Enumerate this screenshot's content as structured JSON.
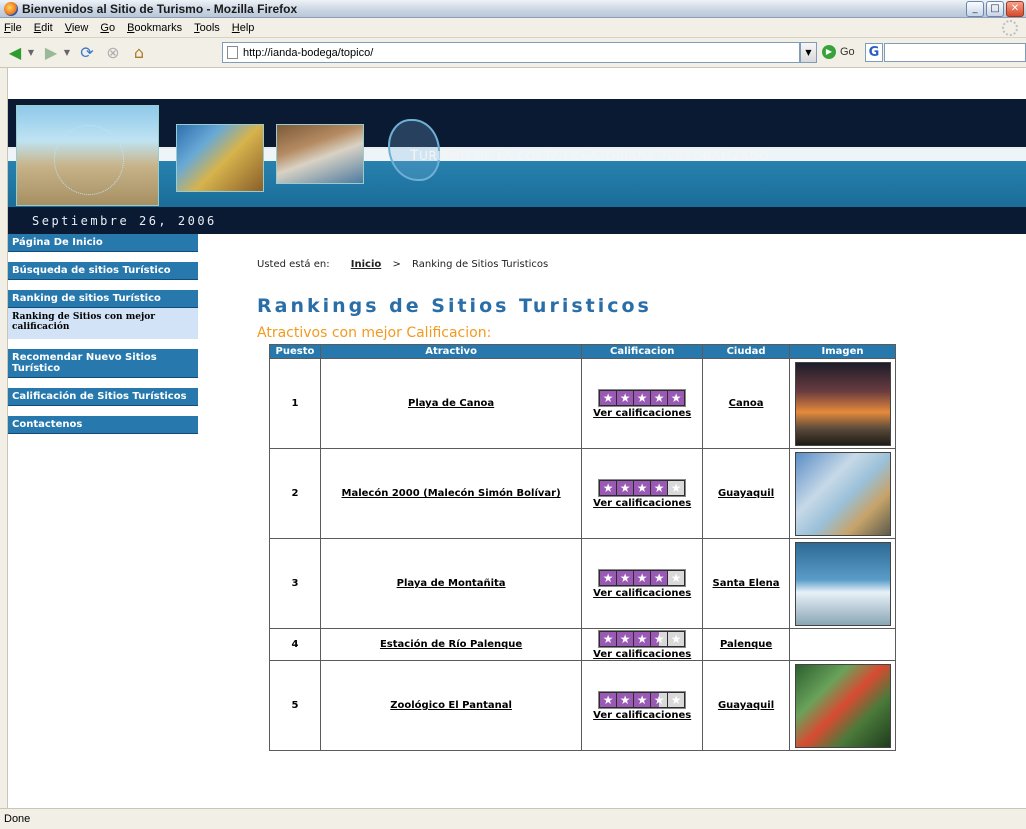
{
  "window": {
    "title": "Bienvenidos al Sitio de Turismo - Mozilla Firefox"
  },
  "menu": {
    "items": [
      "File",
      "Edit",
      "View",
      "Go",
      "Bookmarks",
      "Tools",
      "Help"
    ]
  },
  "navbar": {
    "url": "http://ianda-bodega/topico/",
    "go_label": "Go"
  },
  "banner": {
    "title": "Turismo de la Costa Ecuatoriana Personalizado",
    "date": "Septiembre 26, 2006"
  },
  "sidebar": {
    "items": [
      {
        "label": "Página De Inicio"
      },
      {
        "label": "Búsqueda de sitios Turístico"
      },
      {
        "label": "Ranking de sitios Turístico"
      },
      {
        "label": "Ranking de Sitios con mejor calificación"
      },
      {
        "label": "Recomendar Nuevo Sitios Turístico"
      },
      {
        "label": "Calificación de Sitios Turísticos"
      },
      {
        "label": "Contactenos"
      }
    ]
  },
  "breadcrumb": {
    "prefix": "Usted está en:",
    "home": "Inicio",
    "separator": ">",
    "current": "Ranking de Sitios Turisticos"
  },
  "main": {
    "title": "Rankings de Sitios Turisticos",
    "subtitle": "Atractivos con mejor Calificacion:"
  },
  "table": {
    "headers": [
      "Puesto",
      "Atractivo",
      "Calificacion",
      "Ciudad",
      "Imagen"
    ],
    "rating_link": "Ver calificaciones",
    "rows": [
      {
        "puesto": "1",
        "atractivo": "Playa de Canoa",
        "ciudad": "Canoa",
        "stars": 5,
        "image": "sunset-beach"
      },
      {
        "puesto": "2",
        "atractivo": "Malecón 2000 (Malecón Simón Bolívar)",
        "ciudad": "Guayaquil",
        "stars": 4,
        "image": "city-riverfront"
      },
      {
        "puesto": "3",
        "atractivo": "Playa de Montañita",
        "ciudad": "Santa Elena",
        "stars": 4,
        "image": "surfer-beach"
      },
      {
        "puesto": "4",
        "atractivo": "Estación de Río Palenque",
        "ciudad": "Palenque",
        "stars": 3.5,
        "image": ""
      },
      {
        "puesto": "5",
        "atractivo": "Zoológico El Pantanal",
        "ciudad": "Guayaquil",
        "stars": 3.5,
        "image": "parrot"
      }
    ]
  },
  "status": {
    "text": "Done"
  },
  "colors": {
    "nav_blue": "#2779ad",
    "title_blue": "#2a6ea8",
    "subtitle_orange": "#f39a1e",
    "star_purple": "#9b59b6",
    "banner_dark": "#0b1a33"
  }
}
